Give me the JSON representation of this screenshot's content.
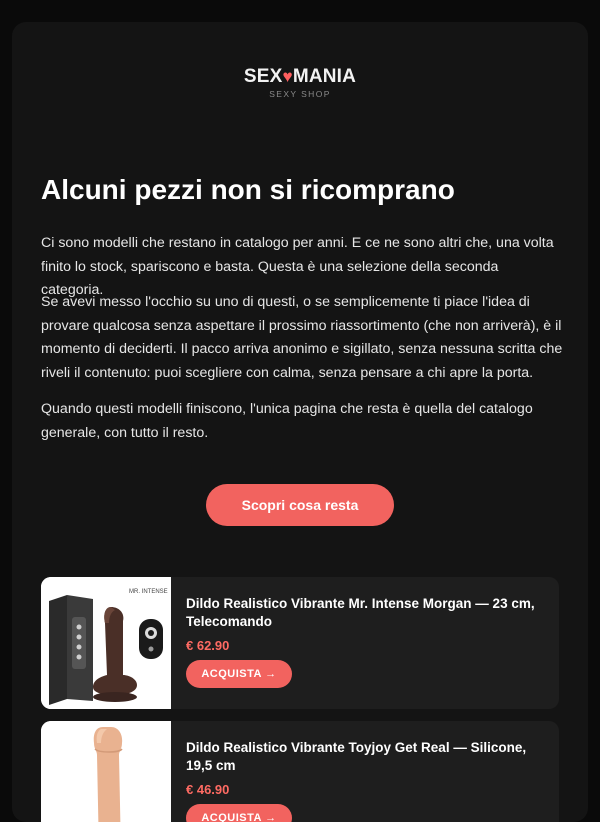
{
  "brand": {
    "name_left": "SEX",
    "heart": "♥",
    "name_right": "MANIA",
    "tagline": "SEXY SHOP",
    "accent_color": "#f2635f"
  },
  "headline": "Alcuni pezzi non si ricomprano",
  "paragraphs": [
    "Ci sono modelli che restano in catalogo per anni. E ce ne sono altri che, una volta finito lo stock, spariscono e basta. Questa è una selezione della seconda categoria.",
    "Se avevi messo l'occhio su uno di questi, o se semplicemente ti piace l'idea di provare qualcosa senza aspettare il prossimo riassortimento (che non arriverà), è il momento di deciderti. Il pacco arriva anonimo e sigillato, senza nessuna scritta che riveli il contenuto: puoi scegliere con calma, senza pensare a chi apre la porta.",
    "Quando questi modelli finiscono, l'unica pagina che resta è quella del catalogo generale, con tutto il resto."
  ],
  "cta_label": "Scopri cosa resta",
  "products": [
    {
      "name": "Dildo Realistico Vibrante Mr. Intense Morgan — 23 cm, Telecomando",
      "price": "€ 62.90",
      "button_label": "ACQUISTA →",
      "image_icon": "product-photo-icon"
    },
    {
      "name": "Dildo Realistico Vibrante Toyjoy Get Real — Silicone, 19,5 cm",
      "price": "€ 46.90",
      "button_label": "ACQUISTA →",
      "image_icon": "product-photo-icon"
    }
  ]
}
